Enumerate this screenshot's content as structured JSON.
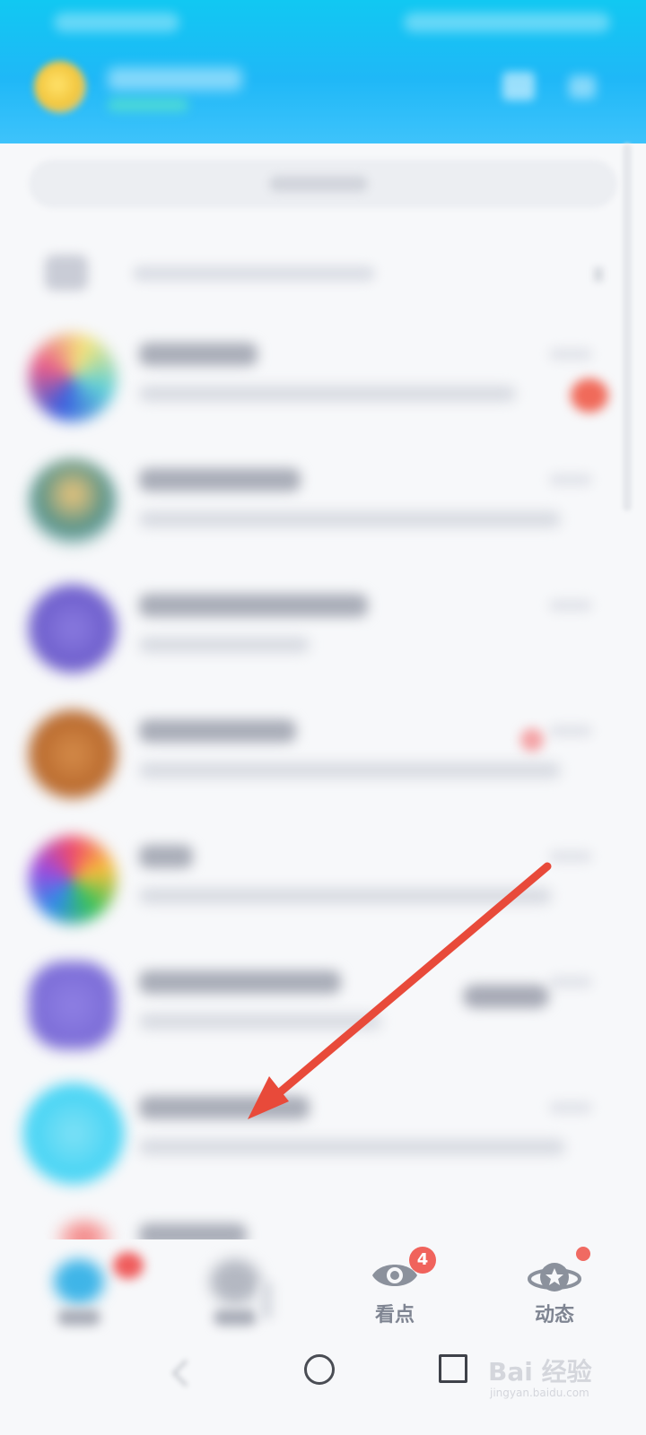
{
  "bottom_nav": {
    "tabs": [
      {
        "label": "",
        "icon": "message-icon",
        "active": true
      },
      {
        "label": "",
        "icon": "contacts-icon"
      },
      {
        "label": "看点",
        "icon": "eye-icon",
        "badge": "4"
      },
      {
        "label": "动态",
        "icon": "planet-star-icon",
        "dot": true
      }
    ]
  },
  "system_bar": {
    "buttons": [
      "back-icon",
      "home-icon",
      "recent-apps-icon"
    ]
  },
  "watermark": {
    "text": "Bai 经验",
    "sub": "jingyan.baidu.com"
  },
  "colors": {
    "header": "#1fb8f7",
    "badge": "#f0635c",
    "annotation_arrow": "#e84a3a"
  }
}
